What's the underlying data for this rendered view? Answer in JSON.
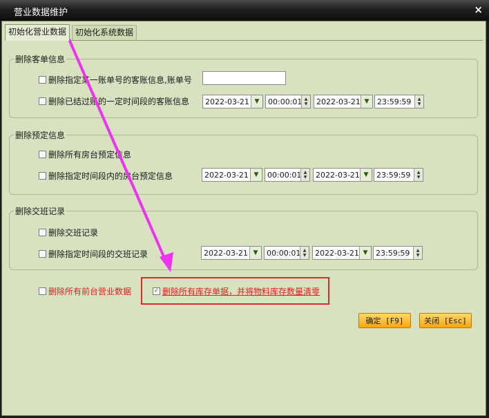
{
  "window": {
    "title": "营业数据维护",
    "close_glyph": "×"
  },
  "tabs": [
    {
      "label": "初始化营业数据"
    },
    {
      "label": "初始化系统数据"
    }
  ],
  "groups": {
    "guest_bill": {
      "title": "删除客单信息",
      "opt1_label": "删除指定某一账单号的客账信息,账单号",
      "opt1_value": "",
      "opt2_label": "删除已结过账的一定时间段的客账信息"
    },
    "reservation": {
      "title": "删除预定信息",
      "opt1_label": "删除所有房台预定信息",
      "opt2_label": "删除指定时间段内的房台预定信息"
    },
    "shift": {
      "title": "删除交班记录",
      "opt1_label": "删除交班记录",
      "opt2_label": "删除指定时间段的交班记录"
    }
  },
  "range": {
    "start_date": "2022-03-21",
    "start_time": "00:00:01",
    "end_date": "2022-03-21",
    "end_time": "23:59:59"
  },
  "bottom": {
    "delete_all_front_label": "删除所有前台营业数据",
    "delete_stock_label": "删除所有库存单据，并将物料库存数量清零",
    "delete_stock_checked_glyph": "✓"
  },
  "buttons": {
    "confirm_label": "确定 [F9]",
    "close_label": "关闭 [Esc]"
  },
  "colors": {
    "accent_red": "#e02020",
    "annotation_magenta": "#ee33ee",
    "highlight_box": "#e02a2a"
  }
}
